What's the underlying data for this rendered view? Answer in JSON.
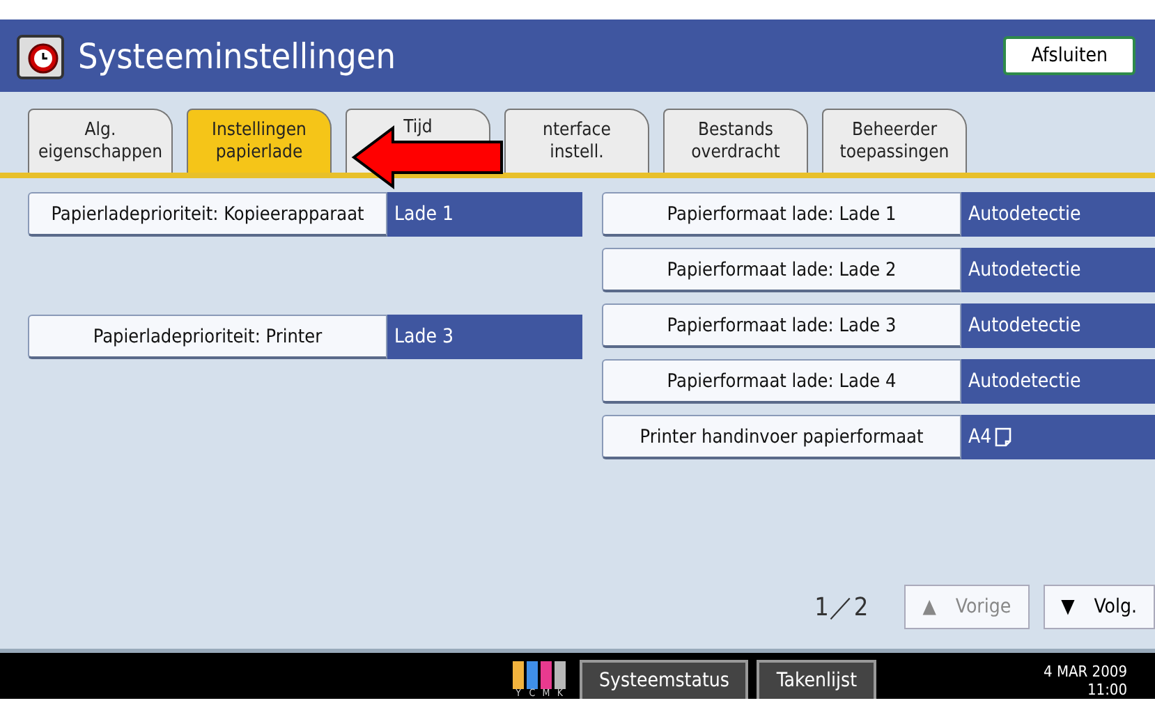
{
  "window": {
    "title": "Systeeminstellingen",
    "close_button": "Afsluiten"
  },
  "tabs": [
    {
      "lines": [
        "Alg.",
        "eigenschappen"
      ],
      "selected": false
    },
    {
      "lines": [
        "Instellingen",
        "papierlade"
      ],
      "selected": true
    },
    {
      "lines": [
        "Tijd"
      ],
      "selected": false
    },
    {
      "lines": [
        "nterface",
        "instell."
      ],
      "selected": false
    },
    {
      "lines": [
        "Bestands",
        "overdracht"
      ],
      "selected": false
    },
    {
      "lines": [
        "Beheerder",
        "toepassingen"
      ],
      "selected": false
    }
  ],
  "settings_left": [
    {
      "label": "Papierladeprioriteit: Kopieerapparaat",
      "value": "Lade 1"
    },
    {
      "label": "Papierladeprioriteit: Printer",
      "value": "Lade 3"
    }
  ],
  "settings_right": [
    {
      "label": "Papierformaat lade: Lade 1",
      "value": "Autodetectie"
    },
    {
      "label": "Papierformaat lade: Lade 2",
      "value": "Autodetectie"
    },
    {
      "label": "Papierformaat lade: Lade 3",
      "value": "Autodetectie"
    },
    {
      "label": "Papierformaat lade: Lade 4",
      "value": "Autodetectie"
    },
    {
      "label": "Printer handinvoer papierformaat",
      "value": "A4",
      "kind": "paper_size"
    }
  ],
  "pager": {
    "page": "1／2",
    "prev": {
      "icon": "▲",
      "label": "Vorige",
      "disabled": true
    },
    "next": {
      "icon": "▼",
      "label": "Volg.",
      "disabled": false
    }
  },
  "status_bar": {
    "toner": [
      {
        "label": "Y",
        "color": "#f2b33d"
      },
      {
        "label": "C",
        "color": "#3f8fe8"
      },
      {
        "label": "M",
        "color": "#e83a8f"
      },
      {
        "label": "K",
        "color": "#b8b8b8"
      }
    ],
    "buttons": [
      "Systeemstatus",
      "Takenlijst"
    ],
    "date": "4 MAR  2009",
    "time": "11:00"
  }
}
